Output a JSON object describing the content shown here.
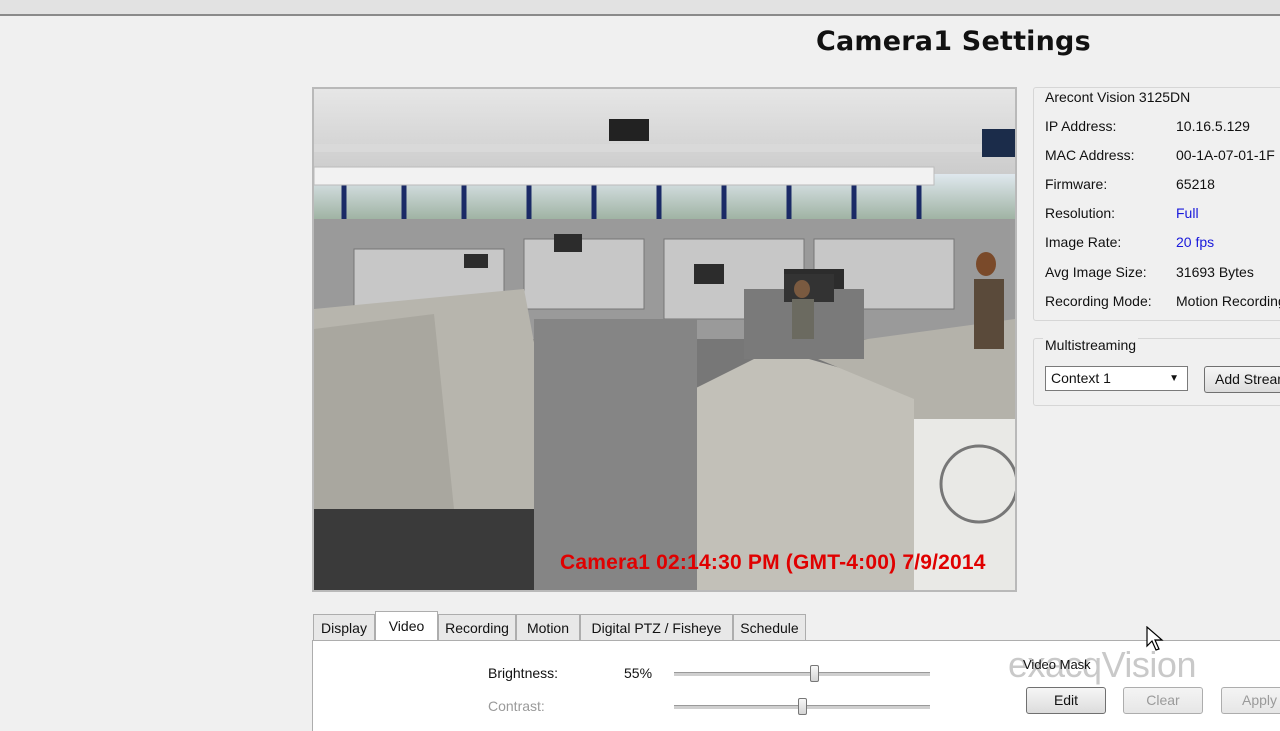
{
  "page_title": "Camera1 Settings",
  "video": {
    "osd_text": "Camera1 02:14:30 PM (GMT-4:00) 7/9/2014"
  },
  "info": {
    "model": "Arecont Vision 3125DN",
    "rows": [
      {
        "label": "IP Address:",
        "value": "10.16.5.129",
        "link": false
      },
      {
        "label": "MAC Address:",
        "value": "00-1A-07-01-1F",
        "link": false
      },
      {
        "label": "Firmware:",
        "value": "65218",
        "link": false
      },
      {
        "label": "Resolution:",
        "value": "Full",
        "link": true
      },
      {
        "label": "Image Rate:",
        "value": "20 fps",
        "link": true
      },
      {
        "label": "Avg Image Size:",
        "value": "31693 Bytes",
        "link": false
      },
      {
        "label": "Recording Mode:",
        "value": "Motion Recording",
        "link": false
      }
    ]
  },
  "multistreaming": {
    "label": "Multistreaming",
    "selected": "Context 1",
    "add_button": "Add Stream"
  },
  "tabs": [
    {
      "label": "Display",
      "active": false
    },
    {
      "label": "Video",
      "active": true
    },
    {
      "label": "Recording",
      "active": false
    },
    {
      "label": "Motion",
      "active": false
    },
    {
      "label": "Digital PTZ / Fisheye",
      "active": false
    },
    {
      "label": "Schedule",
      "active": false
    }
  ],
  "video_tab": {
    "brightness_label": "Brightness:",
    "brightness_value": "55%",
    "brightness_level": 0.55,
    "contrast_label": "Contrast:",
    "contrast_level": 0.5
  },
  "video_mask": {
    "label": "Video Mask",
    "edit": "Edit",
    "clear": "Clear",
    "apply": "Apply"
  },
  "watermark": "exacqVision",
  "colors": {
    "osd": "#e00000",
    "link": "#1a1adb",
    "panel_bg": "#f0f0f0"
  }
}
